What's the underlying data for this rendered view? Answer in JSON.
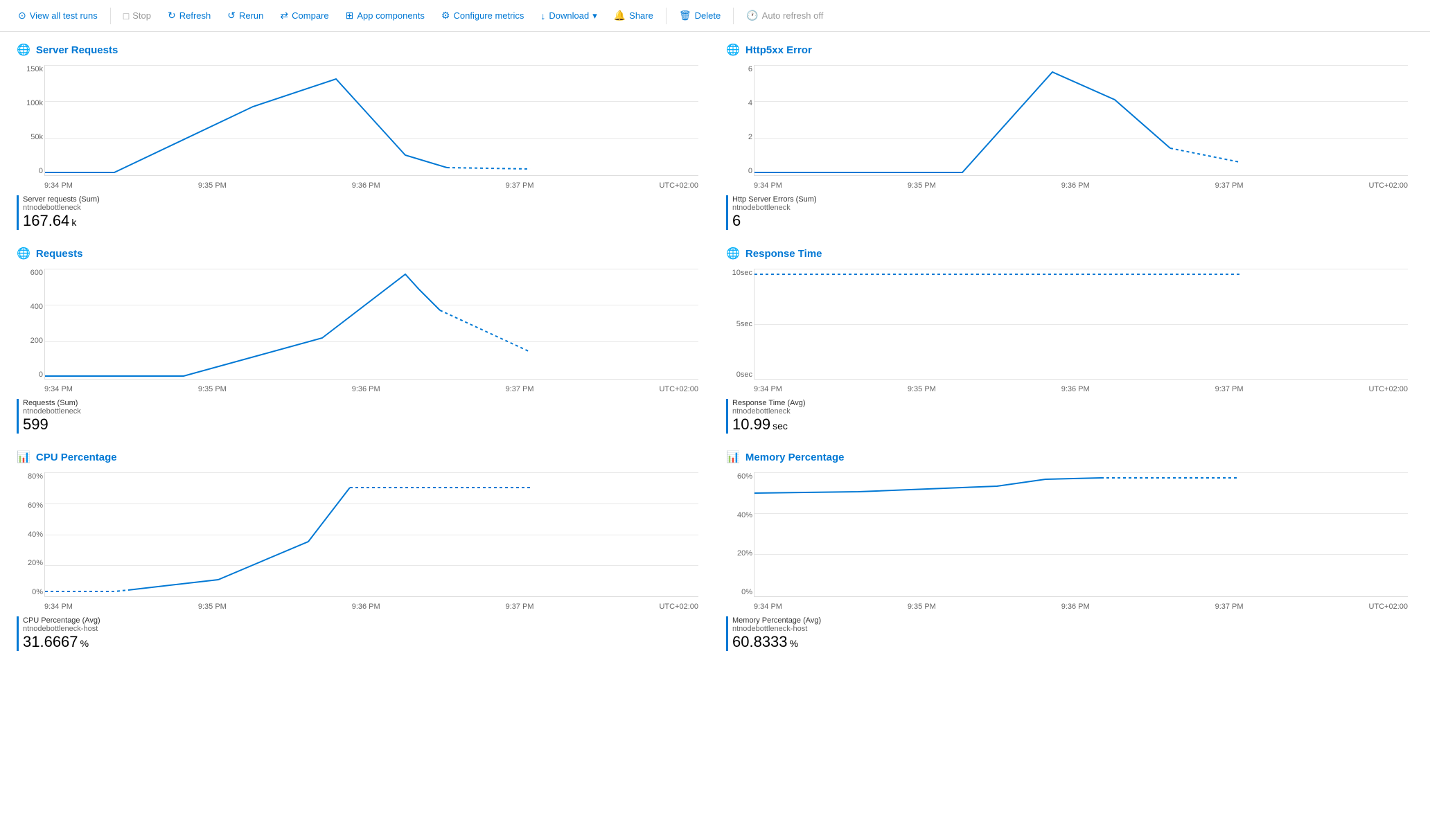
{
  "toolbar": {
    "view_all_label": "View all test runs",
    "stop_label": "Stop",
    "refresh_label": "Refresh",
    "rerun_label": "Rerun",
    "compare_label": "Compare",
    "app_components_label": "App components",
    "configure_metrics_label": "Configure metrics",
    "download_label": "Download",
    "share_label": "Share",
    "delete_label": "Delete",
    "auto_refresh_label": "Auto refresh off"
  },
  "charts": {
    "server_requests": {
      "title": "Server Requests",
      "y_labels": [
        "150k",
        "100k",
        "50k",
        "0"
      ],
      "x_labels": [
        "9:34 PM",
        "9:35 PM",
        "9:36 PM",
        "9:37 PM",
        "UTC+02:00"
      ],
      "metric_label": "Server requests (Sum)",
      "metric_sub": "ntnodebottleneck",
      "metric_value": "167.64",
      "metric_unit": "k"
    },
    "http5xx": {
      "title": "Http5xx Error",
      "y_labels": [
        "6",
        "4",
        "2",
        "0"
      ],
      "x_labels": [
        "9:34 PM",
        "9:35 PM",
        "9:36 PM",
        "9:37 PM",
        "UTC+02:00"
      ],
      "metric_label": "Http Server Errors (Sum)",
      "metric_sub": "ntnodebottleneck",
      "metric_value": "6",
      "metric_unit": ""
    },
    "requests": {
      "title": "Requests",
      "y_labels": [
        "600",
        "400",
        "200",
        "0"
      ],
      "x_labels": [
        "9:34 PM",
        "9:35 PM",
        "9:36 PM",
        "9:37 PM",
        "UTC+02:00"
      ],
      "metric_label": "Requests (Sum)",
      "metric_sub": "ntnodebottleneck",
      "metric_value": "599",
      "metric_unit": ""
    },
    "response_time": {
      "title": "Response Time",
      "y_labels": [
        "10sec",
        "5sec",
        "0sec"
      ],
      "x_labels": [
        "9:34 PM",
        "9:35 PM",
        "9:36 PM",
        "9:37 PM",
        "UTC+02:00"
      ],
      "metric_label": "Response Time (Avg)",
      "metric_sub": "ntnodebottleneck",
      "metric_value": "10.99",
      "metric_unit": " sec"
    },
    "cpu_percentage": {
      "title": "CPU Percentage",
      "y_labels": [
        "80%",
        "60%",
        "40%",
        "20%",
        "0%"
      ],
      "x_labels": [
        "9:34 PM",
        "9:35 PM",
        "9:36 PM",
        "9:37 PM",
        "UTC+02:00"
      ],
      "metric_label": "CPU Percentage (Avg)",
      "metric_sub": "ntnodebottleneck-host",
      "metric_value": "31.6667",
      "metric_unit": " %"
    },
    "memory_percentage": {
      "title": "Memory Percentage",
      "y_labels": [
        "60%",
        "40%",
        "20%",
        "0%"
      ],
      "x_labels": [
        "9:34 PM",
        "9:35 PM",
        "9:36 PM",
        "9:37 PM",
        "UTC+02:00"
      ],
      "metric_label": "Memory Percentage (Avg)",
      "metric_sub": "ntnodebottleneck-host",
      "metric_value": "60.8333",
      "metric_unit": " %"
    }
  }
}
